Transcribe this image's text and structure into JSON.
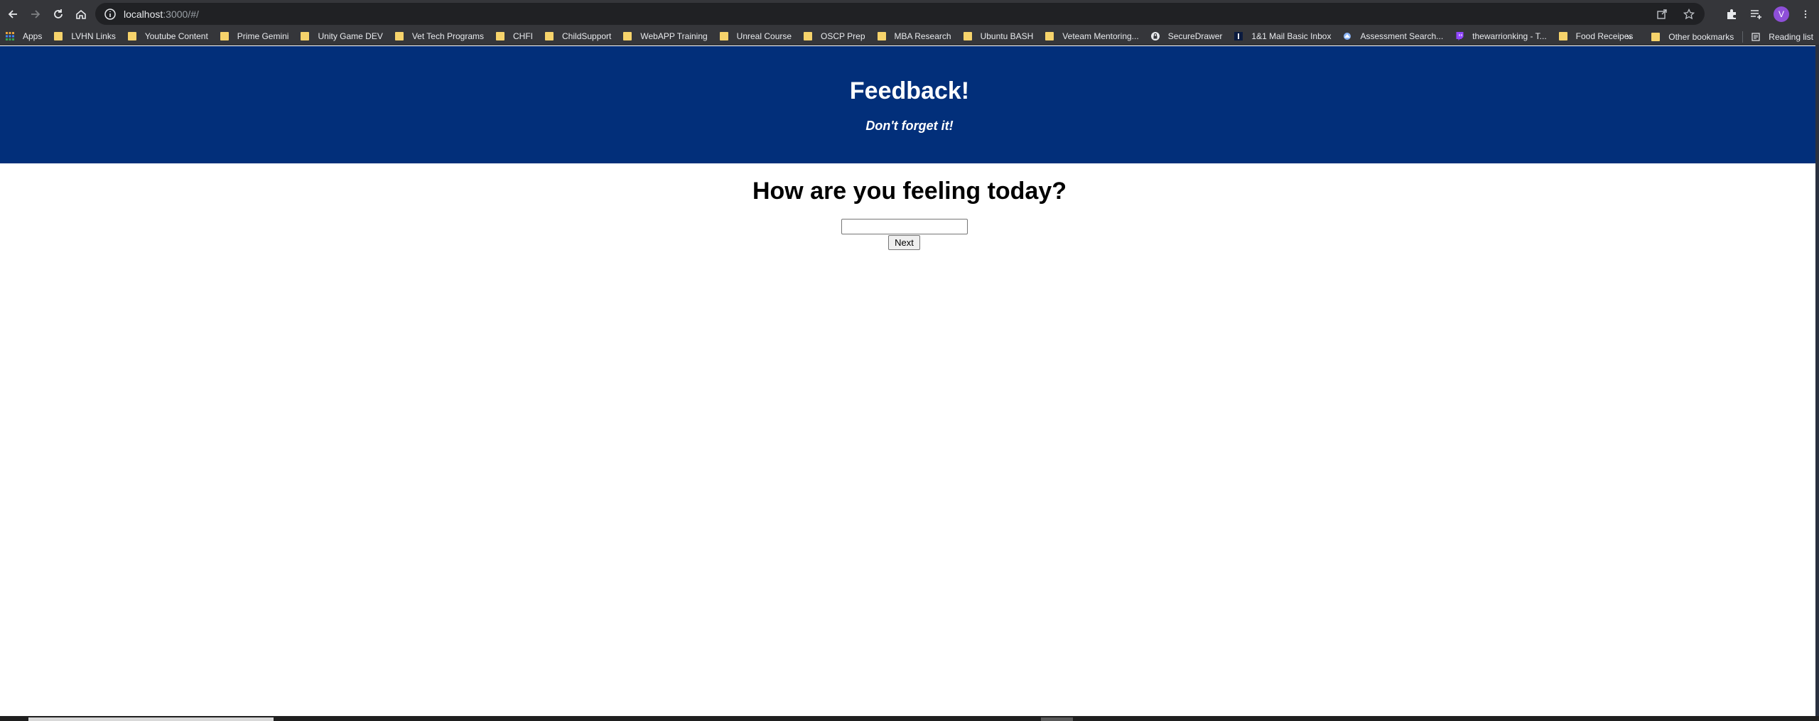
{
  "browser": {
    "url_host": "localhost",
    "url_path": ":3000/#/",
    "profile_initial": "V"
  },
  "bookmarks": [
    {
      "label": "Apps",
      "icon": "apps-grid-icon"
    },
    {
      "label": "LVHN Links",
      "icon": "folder-icon"
    },
    {
      "label": "Youtube Content",
      "icon": "folder-icon"
    },
    {
      "label": "Prime Gemini",
      "icon": "folder-icon"
    },
    {
      "label": "Unity Game DEV",
      "icon": "folder-icon"
    },
    {
      "label": "Vet Tech Programs",
      "icon": "folder-icon"
    },
    {
      "label": "CHFI",
      "icon": "folder-icon"
    },
    {
      "label": "ChildSupport",
      "icon": "folder-icon"
    },
    {
      "label": "WebAPP Training",
      "icon": "folder-icon"
    },
    {
      "label": "Unreal Course",
      "icon": "folder-icon"
    },
    {
      "label": "OSCP Prep",
      "icon": "folder-icon"
    },
    {
      "label": "MBA Research",
      "icon": "folder-icon"
    },
    {
      "label": "Ubuntu BASH",
      "icon": "folder-icon"
    },
    {
      "label": "Veteam Mentoring...",
      "icon": "folder-icon"
    },
    {
      "label": "SecureDrawer",
      "icon": "lock-icon"
    },
    {
      "label": "1&1 Mail Basic Inbox",
      "icon": "mail-icon"
    },
    {
      "label": "Assessment Search...",
      "icon": "globe-icon"
    },
    {
      "label": "thewarrionking - T...",
      "icon": "twitch-icon"
    },
    {
      "label": "Food Receipes",
      "icon": "folder-icon"
    }
  ],
  "bookmarks_right": {
    "overflow": "»",
    "other": "Other bookmarks",
    "reading_list": "Reading list"
  },
  "page": {
    "title": "Feedback!",
    "tagline": "Don't forget it!",
    "question": "How are you feeling today?",
    "input_value": "",
    "next_label": "Next"
  },
  "colors": {
    "header_bg": "#022f7a",
    "chrome_bg": "#35363a",
    "folder": "#f6d36b"
  }
}
